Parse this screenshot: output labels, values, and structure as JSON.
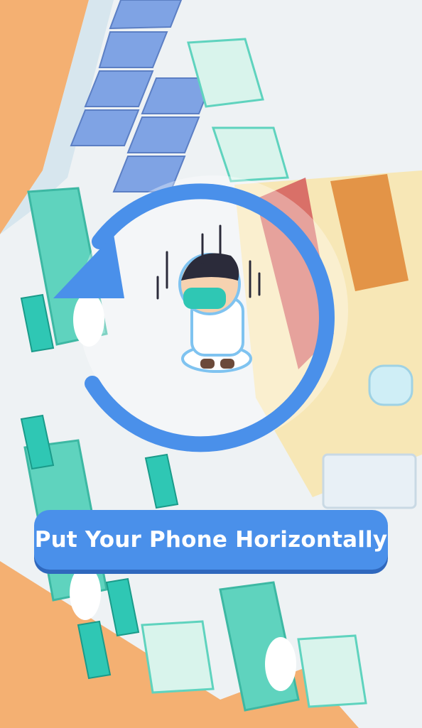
{
  "orientation_prompt": {
    "message": "Put Your Phone Horizontally",
    "icon": "rotate-phone-icon",
    "accent_color": "#4a90ea"
  },
  "scene": {
    "background_color": "#f4b072",
    "floor_color": "#eef2f4",
    "bed_color": "#5fd3be",
    "chair_color": "#7fa3e4"
  }
}
